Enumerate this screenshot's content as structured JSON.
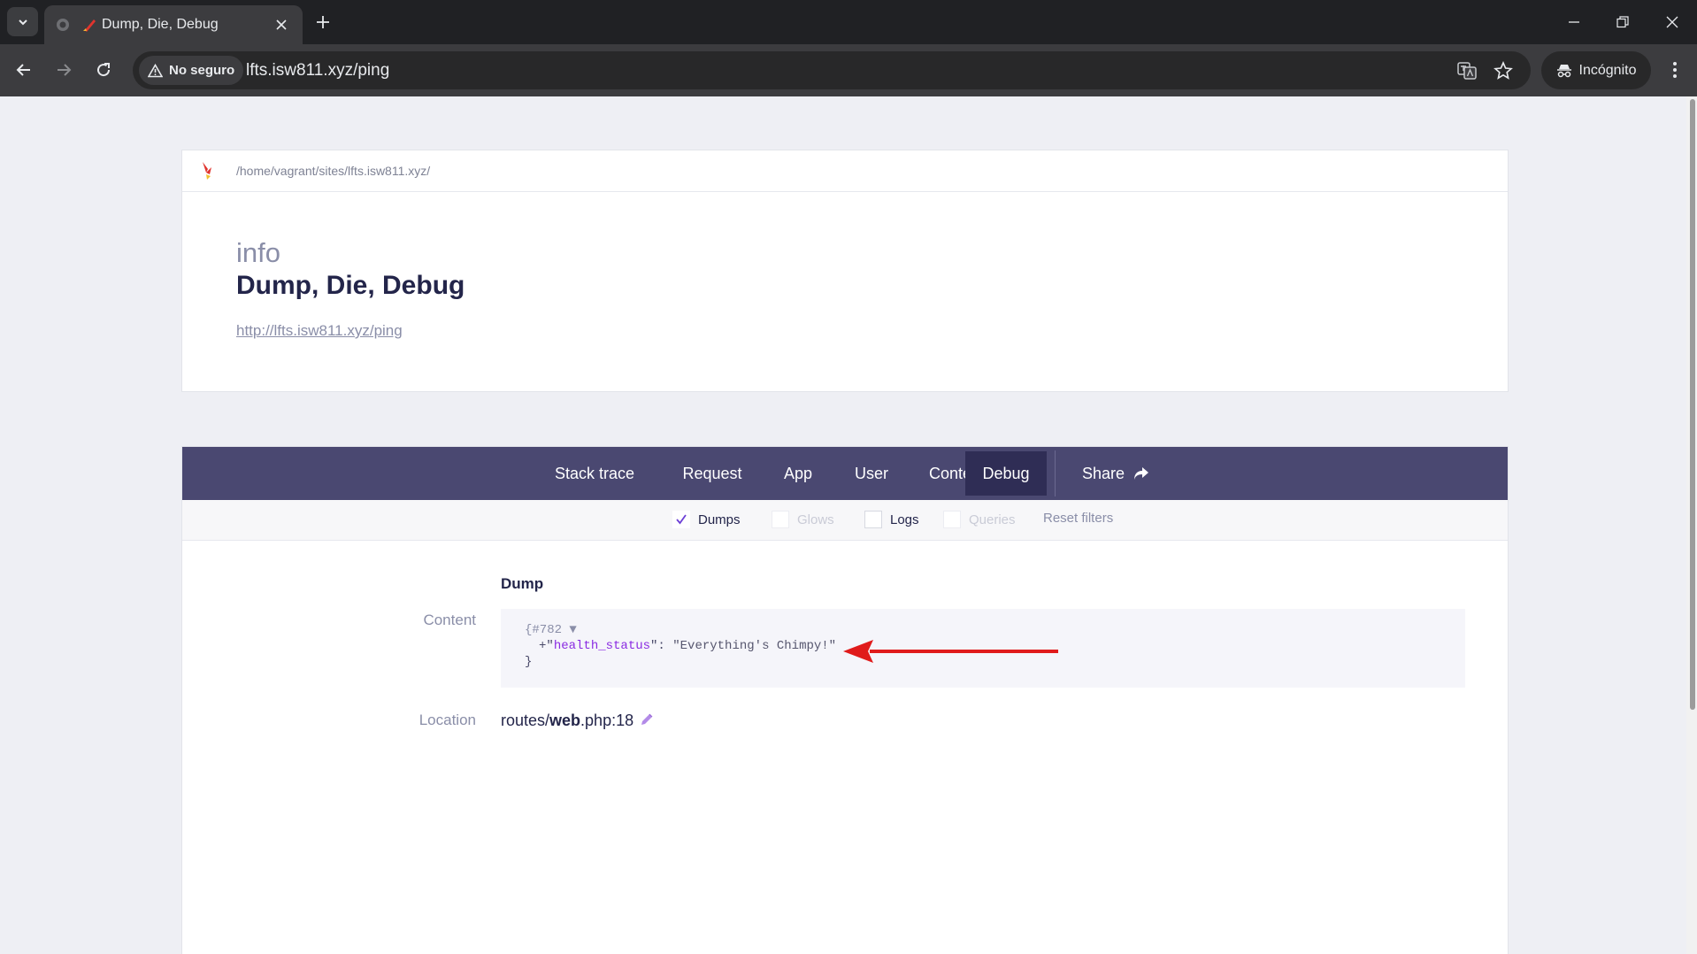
{
  "browser": {
    "tab_title": "Dump, Die, Debug",
    "security_label": "No seguro",
    "url": "lfts.isw811.xyz/ping",
    "incognito_label": "Incógnito"
  },
  "header": {
    "path": "/home/vagrant/sites/lfts.isw811.xyz/",
    "level": "info",
    "title": "Dump, Die, Debug",
    "request_url": "http://lfts.isw811.xyz/ping"
  },
  "nav": {
    "items": [
      {
        "label": "Stack trace"
      },
      {
        "label": "Request"
      },
      {
        "label": "App"
      },
      {
        "label": "User"
      },
      {
        "label": "Context"
      },
      {
        "label": "Debug"
      }
    ],
    "active": "Debug",
    "share_label": "Share"
  },
  "filters": {
    "items": [
      {
        "label": "Dumps",
        "checked": true,
        "enabled": true
      },
      {
        "label": "Glows",
        "checked": false,
        "enabled": false
      },
      {
        "label": "Logs",
        "checked": false,
        "enabled": true
      },
      {
        "label": "Queries",
        "checked": false,
        "enabled": false
      }
    ],
    "reset_label": "Reset filters"
  },
  "dump": {
    "heading": "Dump",
    "content_label": "Content",
    "object_id": "{#782 ▼",
    "prop_prefix": "+\"",
    "prop_key": "health_status",
    "prop_sep": "\": ",
    "prop_value": "\"Everything's Chimpy!\"",
    "close_brace": "}",
    "location_label": "Location",
    "location_dir": "routes/",
    "location_file": "web",
    "location_suffix": ".php:18"
  },
  "colors": {
    "nav_bg": "#4a4871",
    "nav_active": "#2f2d55",
    "accent_purple": "#8a2be2",
    "arrow_red": "#e01b1b"
  }
}
